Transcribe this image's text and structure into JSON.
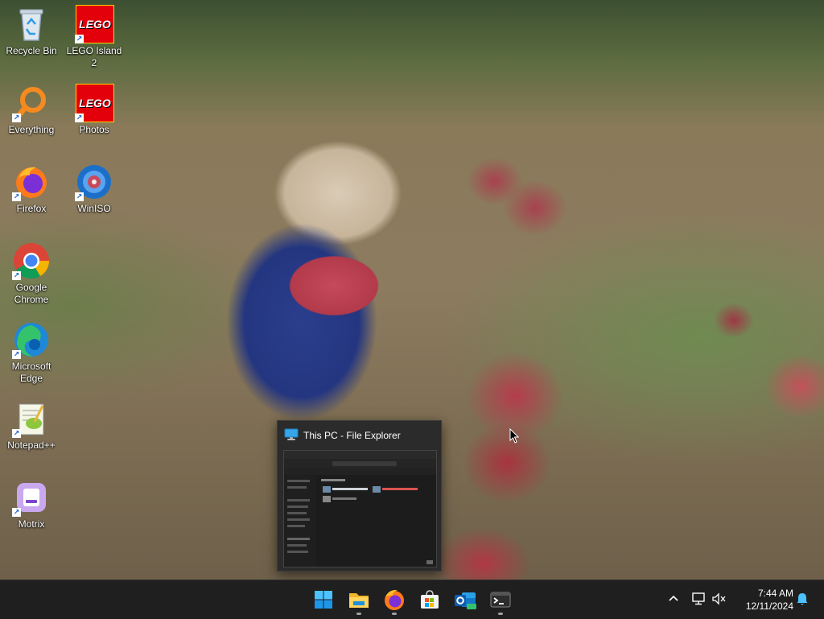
{
  "desktop_icons": [
    {
      "label": "Recycle Bin",
      "icon": "recycle-bin-icon"
    },
    {
      "label": "LEGO Island 2",
      "icon": "lego-icon"
    },
    {
      "label": "Everything",
      "icon": "magnifier-icon"
    },
    {
      "label": "Photos",
      "icon": "lego-icon"
    },
    {
      "label": "Firefox",
      "icon": "firefox-icon"
    },
    {
      "label": "WinISO",
      "icon": "disc-icon"
    },
    {
      "label": "Google Chrome",
      "icon": "chrome-icon"
    },
    {
      "label": "Microsoft Edge",
      "icon": "edge-icon"
    },
    {
      "label": "Notepad++",
      "icon": "notepadpp-icon"
    },
    {
      "label": "Motrix",
      "icon": "motrix-icon"
    }
  ],
  "lego_logo_text": "LEGO",
  "shortcut_arrow": "↗",
  "preview": {
    "title": "This PC - File Explorer",
    "icon": "monitor-icon"
  },
  "taskbar": {
    "apps": [
      {
        "name": "Start",
        "icon": "windows-start-icon"
      },
      {
        "name": "File Explorer",
        "icon": "folder-icon"
      },
      {
        "name": "Firefox",
        "icon": "firefox-icon"
      },
      {
        "name": "Microsoft Store",
        "icon": "store-icon"
      },
      {
        "name": "Outlook (new)",
        "icon": "outlook-icon"
      },
      {
        "name": "Terminal",
        "icon": "terminal-icon"
      }
    ],
    "tray": {
      "time": "7:44 AM",
      "date": "12/11/2024",
      "chevron": "^"
    }
  },
  "colors": {
    "taskbar_bg": "#1f1f1f",
    "accent_blue": "#0078d4",
    "lego_red": "#e3000b"
  }
}
